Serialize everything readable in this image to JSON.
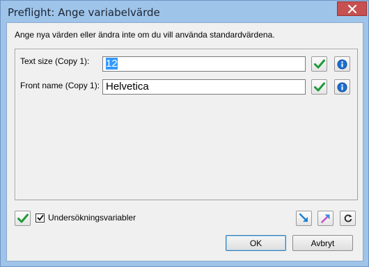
{
  "window": {
    "title": "Preflight: Ange variabelvärde"
  },
  "instruction": "Ange nya värden eller ändra inte om du vill använda standardvärdena.",
  "fields": [
    {
      "label": "Text size (Copy 1):",
      "value": "12"
    },
    {
      "label": "Front name (Copy 1):",
      "value": "Helvetica"
    }
  ],
  "checkbox": {
    "label": "Undersökningsvariabler",
    "checked": true
  },
  "buttons": {
    "ok": "OK",
    "cancel": "Avbryt"
  },
  "icons": {
    "confirm": "green-checkmark-icon",
    "info": "info-icon",
    "import": "import-arrow-icon",
    "export": "export-arrow-icon",
    "reset": "reset-icon"
  },
  "colors": {
    "title_bar": "#9fc4ea",
    "close_button": "#c75050",
    "selection": "#3399ff",
    "check_green": "#1f9a3a",
    "info_blue": "#1c6fd1"
  }
}
